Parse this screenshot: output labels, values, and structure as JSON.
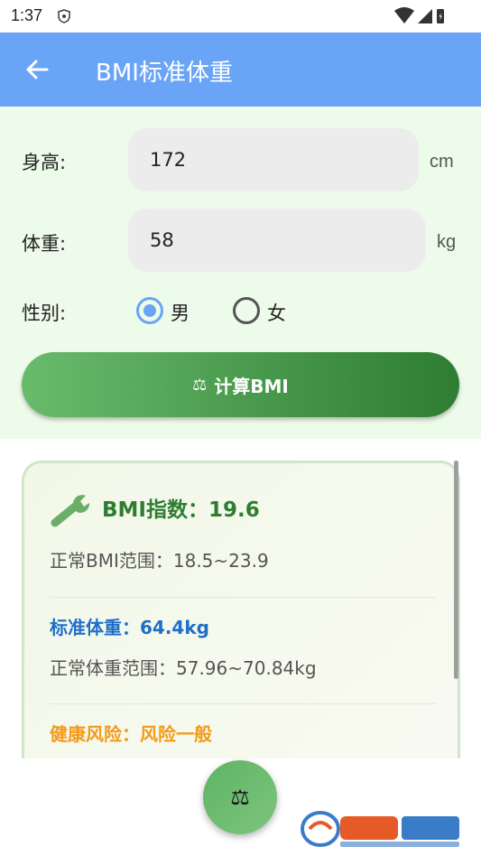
{
  "status": {
    "time": "1:37"
  },
  "appbar": {
    "title": "BMI标准体重"
  },
  "form": {
    "height_label": "身高:",
    "height_value": "172",
    "height_unit": "cm",
    "weight_label": "体重:",
    "weight_value": "58",
    "weight_unit": "kg",
    "gender_label": "性别:",
    "gender_options": [
      "男",
      "女"
    ],
    "gender_selected": "男",
    "calc_icon": "⚖",
    "calc_label": "计算BMI"
  },
  "result": {
    "bmi": "BMI指数：19.6",
    "bmi_range": "正常BMI范围：18.5~23.9",
    "std_weight": "标准体重：64.4kg",
    "weight_range": "正常体重范围：57.96~70.84kg",
    "risk": "健康风险：风险一般"
  },
  "fab": {
    "icon": "⚖"
  },
  "colors": {
    "appbar": "#6aa4f6",
    "form_bg": "#edfbea",
    "bmi_green": "#2e7d32",
    "weight_blue": "#1e6fc9",
    "risk_orange": "#f39a1a"
  }
}
